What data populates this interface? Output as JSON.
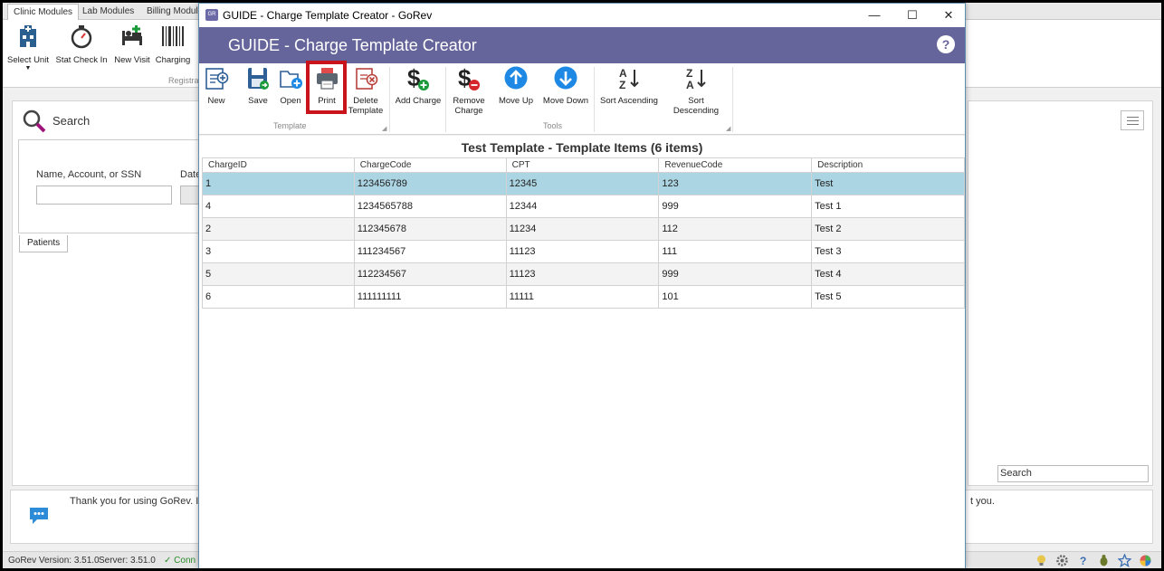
{
  "background": {
    "tabs": [
      "Clinic Modules",
      "Lab Modules",
      "Billing Modules"
    ],
    "ribbon_buttons": [
      "Select Unit",
      "Stat Check In",
      "New Visit",
      "Charging"
    ],
    "ribbon_group": "Registra",
    "search_title": "Search",
    "name_label": "Name, Account, or SSN",
    "date_label": "Date",
    "patients_tab": "Patients",
    "right_search_placeholder": "Search",
    "message": "Thank you for using GoRev.  It",
    "message_tail": "t you.",
    "status_version": "GoRev Version: 3.51.0",
    "status_server": "Server: 3.51.0",
    "status_conn": "✓ Conn"
  },
  "window": {
    "title": "GUIDE - Charge Template Creator - GoRev",
    "header": "GUIDE - Charge Template Creator",
    "controls": {
      "minimize": "—",
      "maximize": "☐",
      "close": "✕"
    },
    "help": "?"
  },
  "ribbon": {
    "template_group": "Template",
    "tools_group": "Tools",
    "buttons": {
      "new": "New",
      "save": "Save",
      "open": "Open",
      "print": "Print",
      "delete_1": "Delete",
      "delete_2": "Template",
      "add_charge": "Add Charge",
      "remove_1": "Remove",
      "remove_2": "Charge",
      "move_up": "Move Up",
      "move_down": "Move Down",
      "sort_asc": "Sort Ascending",
      "sort_desc": "Sort Descending"
    }
  },
  "grid": {
    "title": "Test Template - Template Items (6 items)",
    "columns": [
      "ChargeID",
      "ChargeCode",
      "CPT",
      "RevenueCode",
      "Description"
    ],
    "rows": [
      [
        "1",
        "123456789",
        "12345",
        "123",
        "Test"
      ],
      [
        "4",
        "1234565788",
        "12344",
        "999",
        "Test 1"
      ],
      [
        "2",
        "112345678",
        "11234",
        "112",
        "Test 2"
      ],
      [
        "3",
        "111234567",
        "11123",
        "111",
        "Test 3"
      ],
      [
        "5",
        "112234567",
        "11123",
        "999",
        "Test 4"
      ],
      [
        "6",
        "111111111",
        "11111",
        "101",
        "Test 5"
      ]
    ]
  },
  "colors": {
    "header_band": "#65659b",
    "selected_row": "#acd5e3",
    "highlight": "#c9141c",
    "accent_blue": "#1e88e5"
  }
}
